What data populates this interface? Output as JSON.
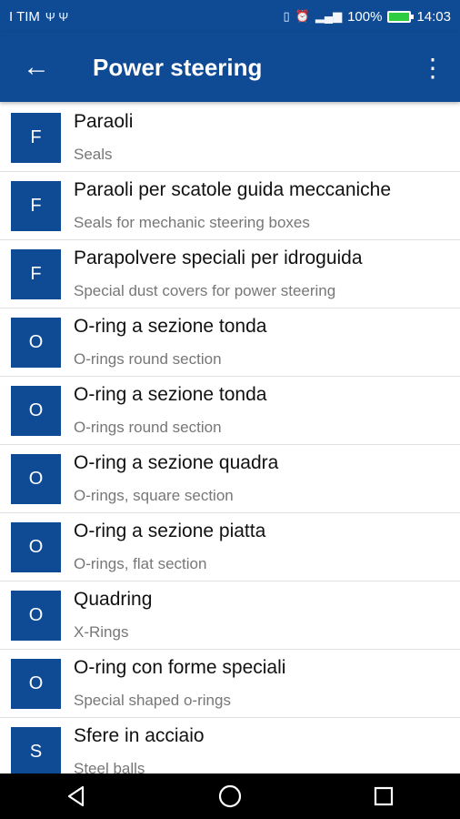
{
  "status": {
    "carrier": "I TIM",
    "usb_icons": "Ψ Ψ",
    "battery": "100%",
    "time": "14:03"
  },
  "appbar": {
    "title": "Power steering"
  },
  "items": [
    {
      "letter": "F",
      "title": "Paraoli",
      "subtitle": "Seals"
    },
    {
      "letter": "F",
      "title": "Paraoli per scatole guida meccaniche",
      "subtitle": "Seals for mechanic steering boxes"
    },
    {
      "letter": "F",
      "title": "Parapolvere speciali per idroguida",
      "subtitle": "Special dust covers for power steering"
    },
    {
      "letter": "O",
      "title": "O-ring a sezione tonda",
      "subtitle": "O-rings round section"
    },
    {
      "letter": "O",
      "title": "O-ring a sezione tonda",
      "subtitle": "O-rings round section"
    },
    {
      "letter": "O",
      "title": "O-ring a sezione quadra",
      "subtitle": "O-rings, square section"
    },
    {
      "letter": "O",
      "title": "O-ring a sezione piatta",
      "subtitle": "O-rings, flat section"
    },
    {
      "letter": "O",
      "title": "Quadring",
      "subtitle": "X-Rings"
    },
    {
      "letter": "O",
      "title": "O-ring con forme speciali",
      "subtitle": "Special shaped o-rings"
    },
    {
      "letter": "S",
      "title": "Sfere in acciaio",
      "subtitle": "Steel balls"
    }
  ]
}
